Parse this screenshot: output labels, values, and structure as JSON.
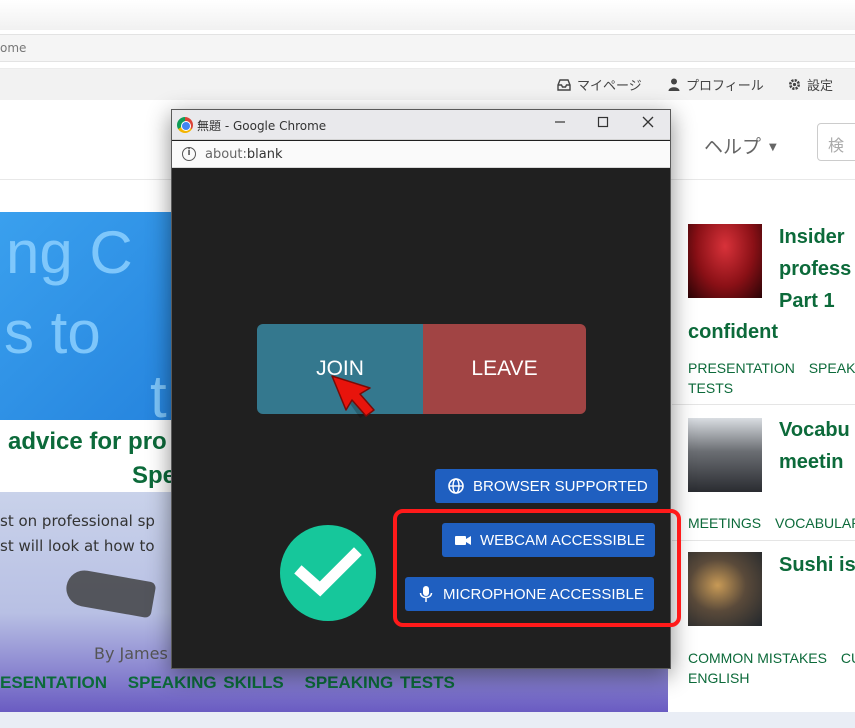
{
  "background": {
    "addr_text": "ome",
    "userbar": {
      "mypage": "マイページ",
      "profile": "プロフィール",
      "settings": "設定"
    },
    "nav": {
      "help": "ヘルプ",
      "search_placeholder": "検"
    },
    "hero_text": [
      "ng C",
      "s to",
      "t"
    ],
    "article": {
      "title_line1": "advice for pro",
      "title_line2": "Spe",
      "excerpt_line1": "st on professional sp",
      "excerpt_line2": "st will look at how to",
      "author": "By James",
      "tags": [
        "ESENTATION",
        "SPEAKING SKILLS",
        "SPEAKING TESTS"
      ]
    },
    "sidebar": {
      "items": [
        {
          "title_lines": [
            "Insider",
            "profess",
            "Part 1",
            "confident"
          ],
          "tags": [
            "PRESENTATION",
            "SPEAK",
            "TESTS"
          ]
        },
        {
          "title_lines": [
            "Vocabu",
            "meetin"
          ],
          "tags": [
            "MEETINGS",
            "VOCABULAR"
          ]
        },
        {
          "title_lines": [
            "Sushi is"
          ],
          "tags": [
            "COMMON MISTAKES",
            "CU",
            "ENGLISH"
          ]
        }
      ]
    }
  },
  "popup": {
    "window_title": "無題 - Google Chrome",
    "address_prefix": "about:",
    "address_value": "blank",
    "join_label": "JOIN",
    "leave_label": "LEAVE",
    "badges": {
      "browser": "BROWSER SUPPORTED",
      "webcam": "WEBCAM ACCESSIBLE",
      "microphone": "MICROPHONE ACCESSIBLE"
    },
    "icons": {
      "browser": "globe-icon",
      "webcam": "video-camera-icon",
      "microphone": "microphone-icon",
      "check": "checkmark-icon"
    }
  },
  "colors": {
    "join": "#34788e",
    "leave": "#a14444",
    "badge": "#1f5fc0",
    "check": "#16c79b",
    "highlight": "#ff1a1a",
    "tag_green": "#0c6a3a"
  }
}
